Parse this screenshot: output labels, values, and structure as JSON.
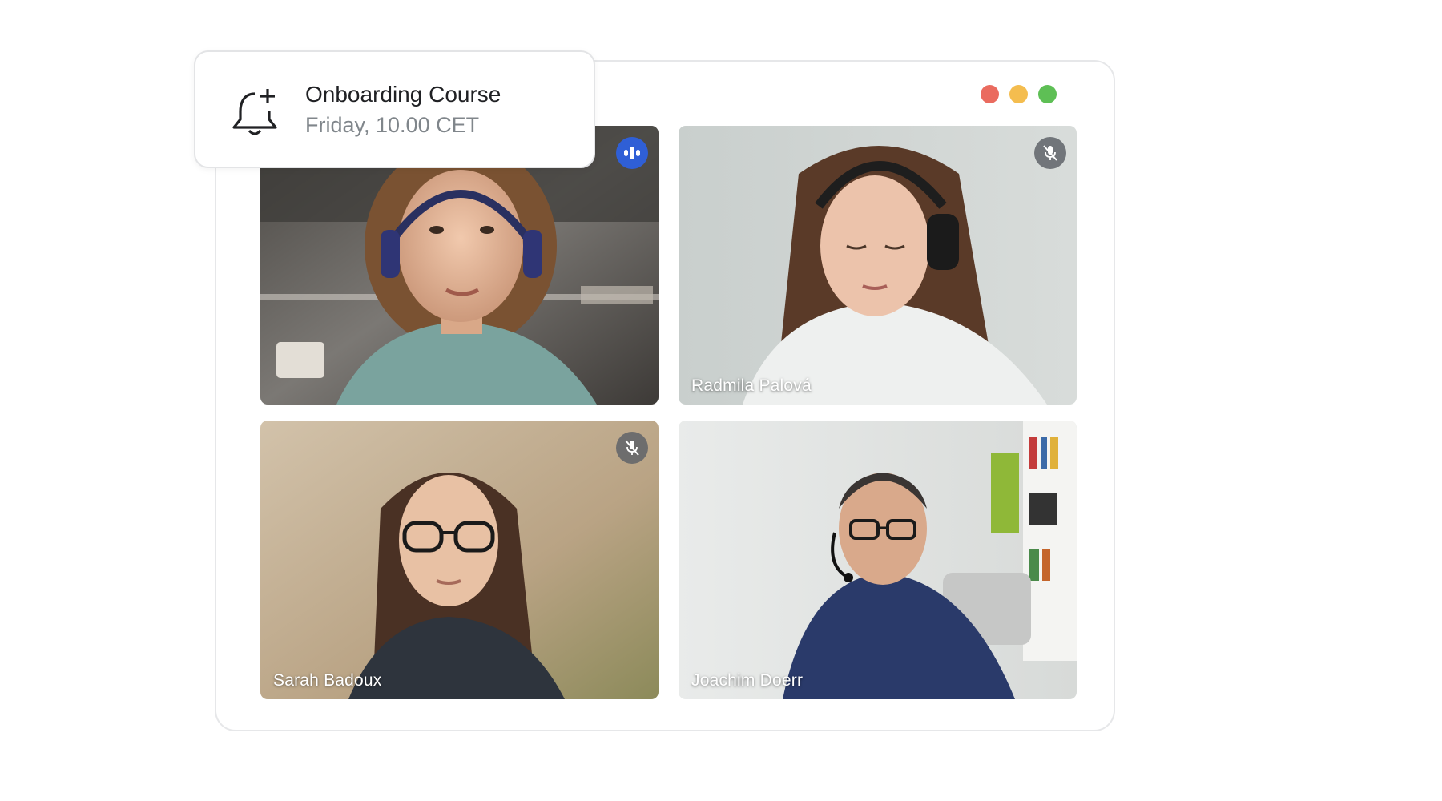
{
  "window": {
    "traffic_lights": {
      "close_color": "#ea6b5f",
      "minimize_color": "#f4bd4f",
      "maximize_color": "#5ebf55"
    }
  },
  "notification": {
    "title": "Onboarding Course",
    "subtitle": "Friday, 10.00 CET",
    "icon": "bell-plus-icon"
  },
  "participants": [
    {
      "name": "",
      "status": "speaking",
      "icon": "speaking-icon"
    },
    {
      "name": "Radmila Palová",
      "status": "muted",
      "icon": "mic-off-icon"
    },
    {
      "name": "Sarah Badoux",
      "status": "muted",
      "icon": "mic-off-icon"
    },
    {
      "name": "Joachim Doerr",
      "status": "unmuted",
      "icon": ""
    }
  ],
  "colors": {
    "speaking_accent": "#2f5fd6",
    "muted_badge": "#5f6368"
  }
}
